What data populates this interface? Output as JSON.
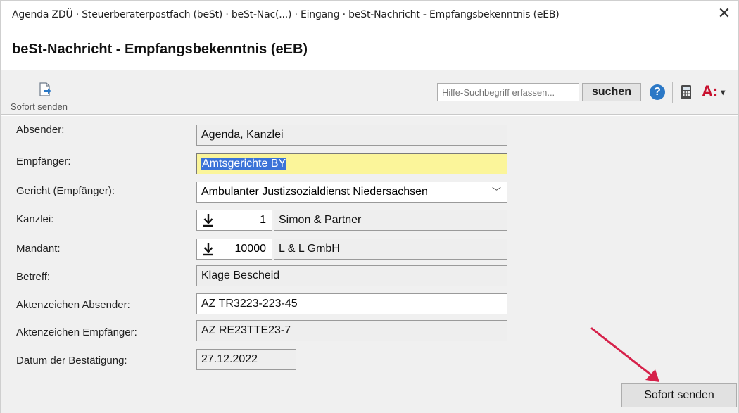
{
  "window": {
    "title": "Agenda ZDÜ · Steuerberaterpostfach (beSt) · beSt-Nac(...) · Eingang · beSt-Nachricht - Empfangsbekenntnis (eEB)",
    "close_glyph": "✕",
    "heading": "beSt-Nachricht - Empfangsbekenntnis (eEB)"
  },
  "toolbar": {
    "send_icon": "send-document-icon",
    "send_label": "Sofort senden",
    "search_placeholder": "Hilfe-Suchbegriff erfassen...",
    "search_button": "suchen",
    "help_glyph": "?",
    "agenda_glyph": "A:",
    "agenda_caret": "▾"
  },
  "form": {
    "absender": {
      "label": "Absender:",
      "value": "Agenda, Kanzlei"
    },
    "empfaenger": {
      "label": "Empfänger:",
      "value": "Amtsgerichte BY"
    },
    "gericht": {
      "label": "Gericht (Empfänger):",
      "value": "Ambulanter Justizsozialdienst Niedersachsen",
      "chevron": "﹀"
    },
    "kanzlei": {
      "label": "Kanzlei:",
      "number": "1",
      "name": "Simon & Partner"
    },
    "mandant": {
      "label": "Mandant:",
      "number": "10000",
      "name": "L & L GmbH"
    },
    "betreff": {
      "label": "Betreff:",
      "value": "Klage Bescheid"
    },
    "az_absender": {
      "label": "Aktenzeichen Absender:",
      "value": "AZ TR3223-223-45"
    },
    "az_empfaenger": {
      "label": "Aktenzeichen Empfänger:",
      "value": "AZ RE23TTE23-7"
    },
    "datum": {
      "label": "Datum der Bestätigung:",
      "value": "27.12.2022"
    }
  },
  "footer": {
    "send_button": "Sofort senden"
  },
  "colors": {
    "annotation_arrow": "#d6214a",
    "focused_field": "#fbf59a",
    "selection": "#3b73d8",
    "agenda_brand": "#c8102e"
  }
}
